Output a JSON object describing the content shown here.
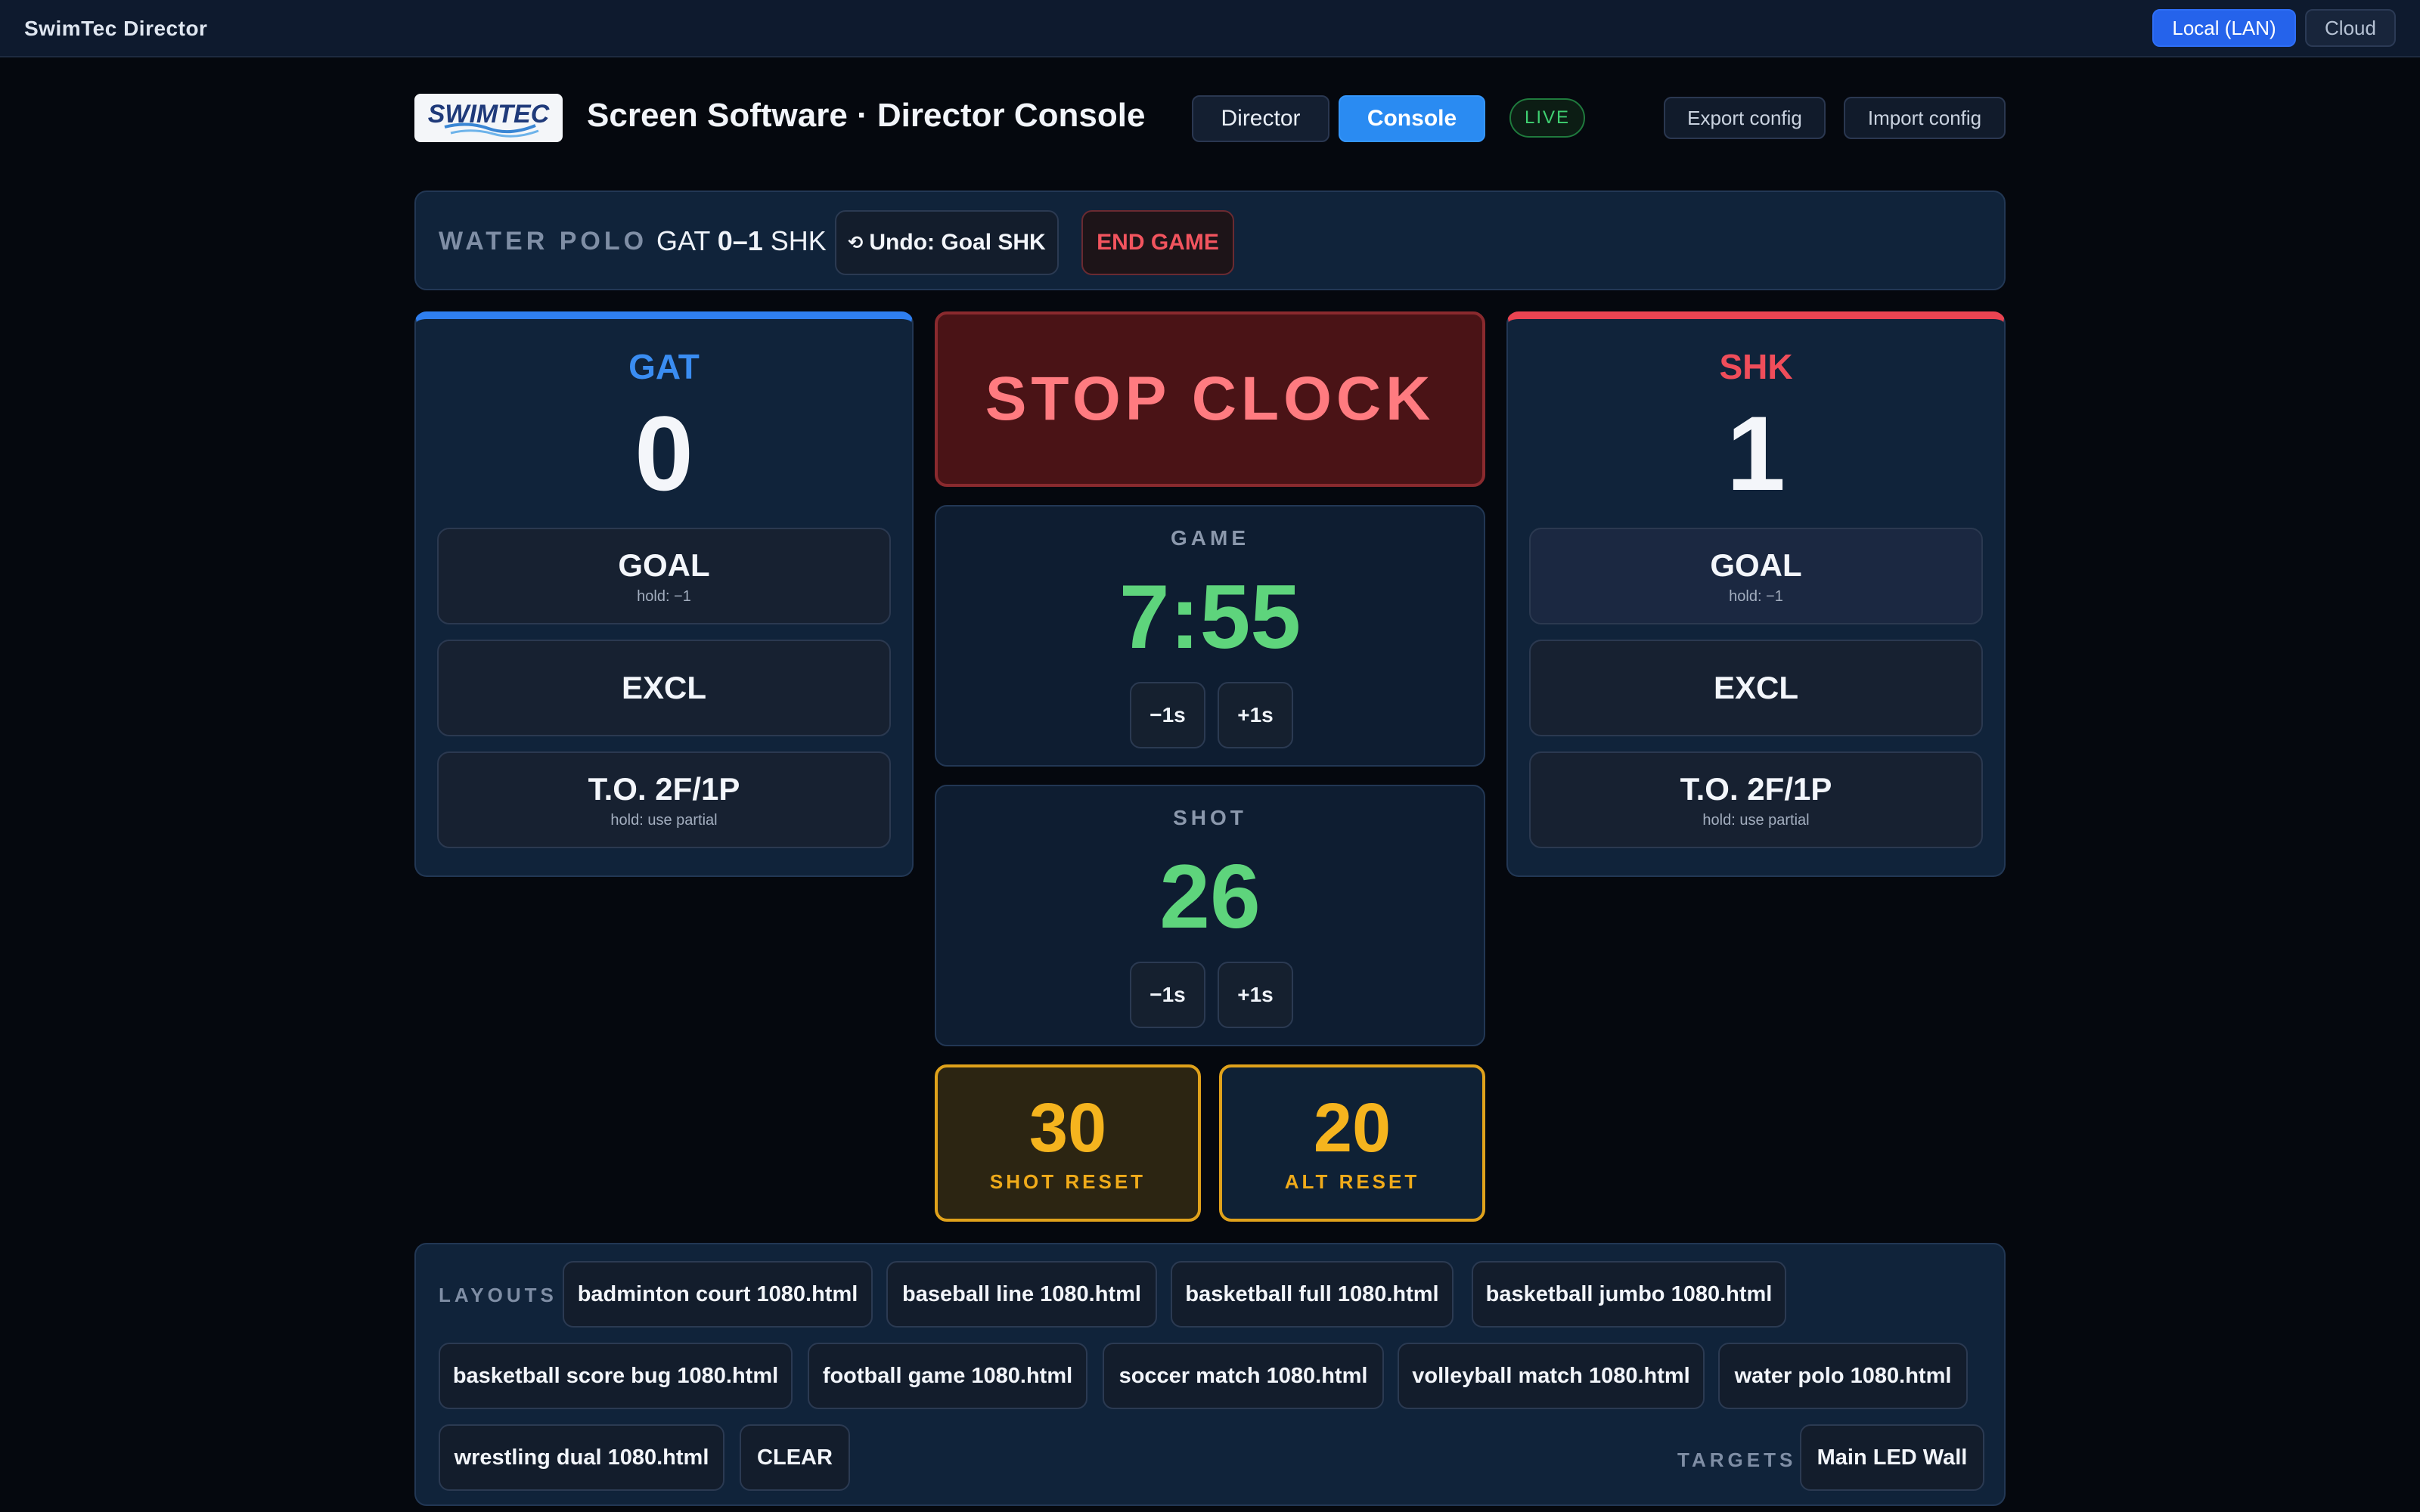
{
  "app": {
    "title": "SwimTec Director"
  },
  "connection": {
    "local_label": "Local (LAN)",
    "cloud_label": "Cloud",
    "active": "Local (LAN)"
  },
  "header": {
    "logo_text": "SWIMTEC",
    "title": "Screen Software · Director Console",
    "tabs": [
      {
        "label": "Director"
      },
      {
        "label": "Console",
        "active": true
      }
    ],
    "live_label": "LIVE",
    "export_label": "Export config",
    "import_label": "Import config"
  },
  "game": {
    "sport": "WATER POLO",
    "home_abbr": "GAT",
    "score_text": "0–1",
    "away_abbr": "SHK",
    "undo_icon": "undo-icon",
    "undo_label": "Undo: Goal SHK",
    "end_label": "END GAME"
  },
  "teams": {
    "home": {
      "name": "GAT",
      "score": "0",
      "color": "#2f7ff0",
      "goal_label": "GOAL",
      "goal_hint": "hold: −1",
      "excl_label": "EXCL",
      "to_label": "T.O. 2F/1P",
      "to_hint": "hold: use partial"
    },
    "away": {
      "name": "SHK",
      "score": "1",
      "color": "#ea4452",
      "goal_label": "GOAL",
      "goal_hint": "hold: −1",
      "excl_label": "EXCL",
      "to_label": "T.O. 2F/1P",
      "to_hint": "hold: use partial"
    }
  },
  "clocks": {
    "stop_label": "STOP CLOCK",
    "game": {
      "label": "GAME",
      "value": "7:55",
      "minus_label": "−1s",
      "plus_label": "+1s"
    },
    "shot": {
      "label": "SHOT",
      "value": "26",
      "minus_label": "−1s",
      "plus_label": "+1s"
    }
  },
  "resets": {
    "shot": {
      "value": "30",
      "label": "SHOT RESET"
    },
    "alt": {
      "value": "20",
      "label": "ALT RESET"
    }
  },
  "layouts": {
    "label": "LAYOUTS",
    "items": [
      "badminton court 1080.html",
      "baseball line 1080.html",
      "basketball full 1080.html",
      "basketball jumbo 1080.html",
      "basketball score bug 1080.html",
      "football game 1080.html",
      "soccer match 1080.html",
      "volleyball match 1080.html",
      "water polo 1080.html",
      "wrestling dual 1080.html"
    ],
    "clear_label": "CLEAR",
    "targets_label": "TARGETS",
    "target": "Main LED Wall"
  },
  "colors": {
    "accent_blue": "#2a8bf2",
    "home": "#2f7ff0",
    "away": "#ea4452",
    "clock_green": "#5ed47c",
    "reset_amber": "#f5b41e",
    "stop_red": "#ff7b80",
    "live_green": "#3fd071"
  }
}
